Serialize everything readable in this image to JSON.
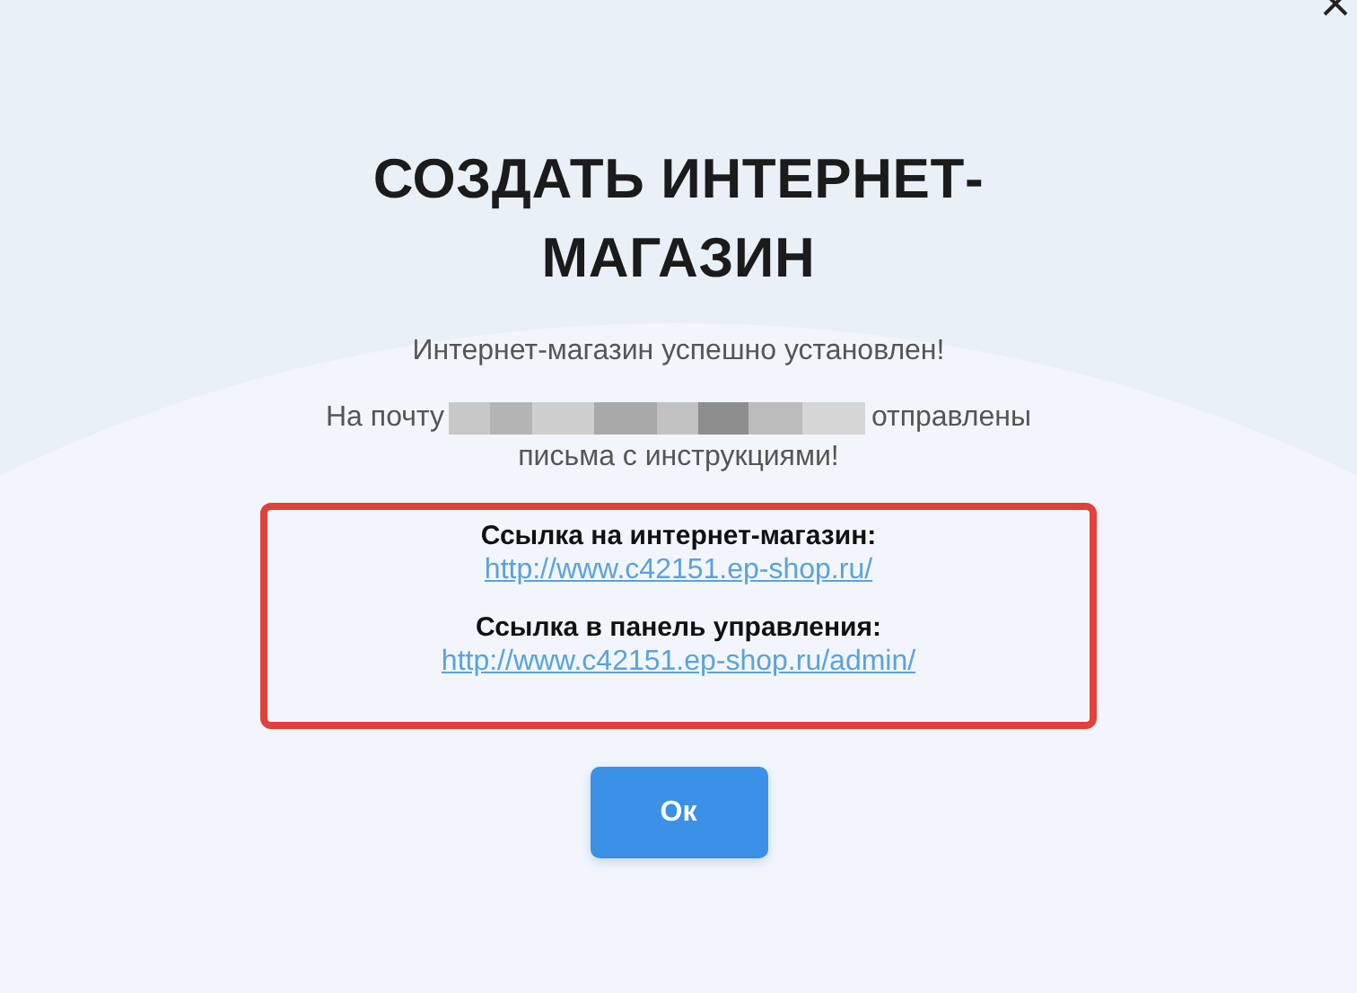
{
  "dialog": {
    "title": "СОЗДАТЬ ИНТЕРНЕТ-МАГАЗИН",
    "message": "Интернет-магазин успешно установлен!",
    "email_notice": {
      "before": "На почту",
      "after": "отправлены",
      "continuation": "письма с инструкциями!"
    },
    "links": [
      {
        "label": "Ссылка на интернет-магазин:",
        "url": "http://www.c42151.ep-shop.ru/"
      },
      {
        "label": "Ссылка в панель управления:",
        "url": "http://www.c42151.ep-shop.ru/admin/"
      }
    ],
    "button": "Ок"
  }
}
